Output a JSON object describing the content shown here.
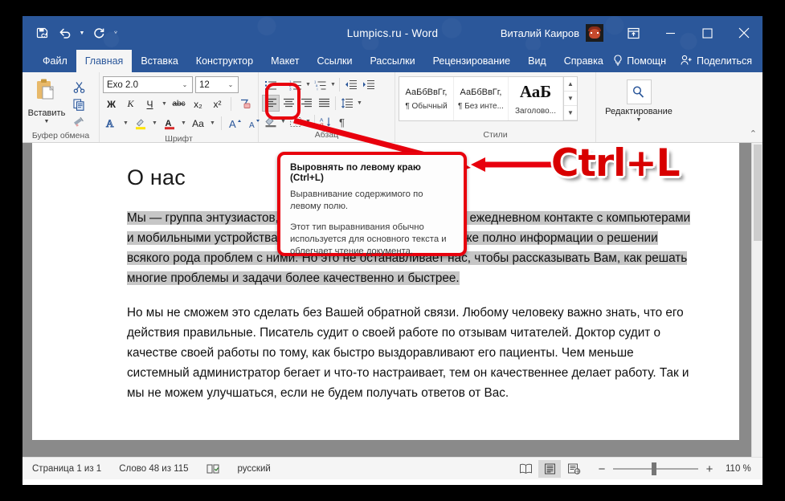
{
  "titlebar": {
    "document_title": "Lumpics.ru  -  Word",
    "user_name": "Виталий Каиров",
    "qat": [
      {
        "name": "save-icon",
        "label": "Сохранить"
      },
      {
        "name": "undo-icon",
        "label": "Отменить"
      },
      {
        "name": "redo-icon",
        "label": "Вернуть"
      },
      {
        "name": "customize-qat-icon",
        "label": "Настройка панели быстрого доступа"
      }
    ],
    "ribbon_display_label": "Параметры отображения ленты",
    "minimize_label": "Свернуть",
    "maximize_label": "Развернуть",
    "close_label": "Закрыть"
  },
  "tabs": {
    "items": [
      {
        "label": "Файл",
        "active": false
      },
      {
        "label": "Главная",
        "active": true
      },
      {
        "label": "Вставка",
        "active": false
      },
      {
        "label": "Конструктор",
        "active": false
      },
      {
        "label": "Макет",
        "active": false
      },
      {
        "label": "Ссылки",
        "active": false
      },
      {
        "label": "Рассылки",
        "active": false
      },
      {
        "label": "Рецензирование",
        "active": false
      },
      {
        "label": "Вид",
        "active": false
      },
      {
        "label": "Справка",
        "active": false
      }
    ],
    "tell_me": "Помощн",
    "share": "Поделиться"
  },
  "ribbon": {
    "clipboard": {
      "label": "Буфер обмена",
      "paste_label": "Вставить",
      "cut_label": "Вырезать",
      "copy_label": "Копировать",
      "format_painter_label": "Формат по образцу"
    },
    "font": {
      "label": "Шрифт",
      "font_name": "Exo 2.0",
      "font_size": "12",
      "bold": "Ж",
      "italic": "К",
      "underline": "Ч",
      "strikethrough": "abc",
      "subscript": "x₂",
      "superscript": "x²",
      "clear_format_label": "Очистить формат",
      "text_effects_label": "Текстовые эффекты",
      "highlight_label": "Цвет выделения текста",
      "font_color_label": "Цвет шрифта",
      "change_case": "Aa",
      "grow_font": "A",
      "shrink_font": "A"
    },
    "paragraph": {
      "label": "Абзац",
      "bullets_label": "Маркеры",
      "numbering_label": "Нумерация",
      "multilevel_label": "Многоуровневый список",
      "decrease_indent_label": "Уменьшить отступ",
      "increase_indent_label": "Увеличить отступ",
      "align_left_label": "Выровнять по левому краю",
      "align_center_label": "По центру",
      "align_right_label": "По правому краю",
      "justify_label": "По ширине",
      "line_spacing_label": "Интервал",
      "shading_label": "Заливка",
      "borders_label": "Границы",
      "sort_label": "Сортировка",
      "show_marks_label": "Отобразить все знаки"
    },
    "styles": {
      "label": "Стили",
      "items": [
        {
          "sample": "АаБбВвГг,",
          "name": "¶ Обычный"
        },
        {
          "sample": "АаБбВвГг,",
          "name": "¶ Без инте..."
        },
        {
          "sample": "АаБ",
          "name": "Заголово..."
        }
      ]
    },
    "editing": {
      "label": "Редактирование",
      "icon": "search-icon"
    },
    "collapse_label": "Свернуть ленту"
  },
  "document": {
    "heading": "О нас",
    "paragraph1": "Мы — группа энтузиастов, цель которых — помогать Вам в ежедневном контакте с компьютерами и мобильными устройствами. Мы знаем, что в интернете уже полно информации о решении всякого рода проблем с ними. Но это не останавливает нас, чтобы рассказывать Вам, как решать многие проблемы и задачи более качественно и быстрее.",
    "paragraph2": "Но мы не сможем это сделать без Вашей обратной связи. Любому человеку важно знать, что его действия правильные. Писатель судит о своей работе по отзывам читателей. Доктор судит о качестве своей работы по тому, как быстро выздоравливают его пациенты. Чем меньше системный администратор бегает и что-то настраивает, тем он качественнее делает работу. Так и мы не можем улучшаться, если не будем получать ответов от Вас.",
    "selection_color": "#c6c6c6"
  },
  "statusbar": {
    "page": "Страница 1 из 1",
    "words": "Слово 48 из 115",
    "proofing_icon": "proofing-icon",
    "language": "русский",
    "views": [
      {
        "name": "read-mode-icon",
        "active": false
      },
      {
        "name": "print-layout-icon",
        "active": true
      },
      {
        "name": "web-layout-icon",
        "active": false
      }
    ],
    "zoom_out": "−",
    "zoom_in": "+",
    "zoom_value": "110 %"
  },
  "annotations": {
    "tooltip": {
      "title": "Выровнять по левому краю (Ctrl+L)",
      "line1": "Выравнивание содержимого по левому полю.",
      "line2": "Этот тип выравнивания обычно используется для основного текста и облегчает чтение документа."
    },
    "callout": "Ctrl+L",
    "highlight_color": "#e8000d",
    "callout_color": "#d80000"
  }
}
